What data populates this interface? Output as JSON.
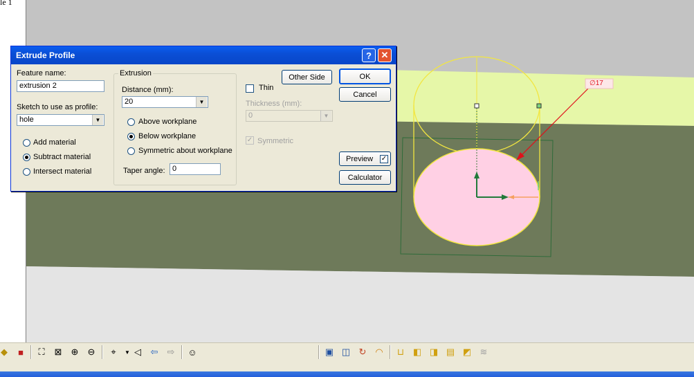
{
  "doc": {
    "fragment": "le 1"
  },
  "dialog": {
    "title": "Extrude Profile",
    "help": "?",
    "close": "✕",
    "feature_name_label": "Feature name:",
    "feature_name_value": "extrusion 2",
    "sketch_label": "Sketch to use as profile:",
    "sketch_value": "hole",
    "ops": [
      "Add material",
      "Subtract material",
      "Intersect material"
    ],
    "ops_selected": 1,
    "extrusion_group": "Extrusion",
    "distance_label": "Distance (mm):",
    "distance_value": "20",
    "direction": [
      "Above workplane",
      "Below workplane",
      "Symmetric about workplane"
    ],
    "direction_selected": 1,
    "taper_label": "Taper angle:",
    "taper_value": "0",
    "other_side": "Other Side",
    "thin_label": "Thin",
    "thin_checked": false,
    "thickness_label": "Thickness (mm):",
    "thickness_value": "0",
    "symmetric_label": "Symmetric",
    "symmetric_checked": true,
    "ok": "OK",
    "cancel": "Cancel",
    "preview": "Preview",
    "preview_checked": true,
    "calculator": "Calculator"
  },
  "viewport": {
    "dimension_label": "∅17"
  },
  "colors": {
    "sky": "#c3c3c3",
    "top_face": "#e6f7a8",
    "side_face": "#6e7a5a",
    "floor": "#e4e4e4",
    "profile_fill": "#ffd0e4",
    "profile_edge": "#f2e640",
    "dim_arrow": "#e0101a"
  },
  "toolbar": {
    "icons": [
      "solid-view-icon",
      "shaded-box-icon",
      "zoom-fit-icon",
      "zoom-window-icon",
      "zoom-in-icon",
      "zoom-out-icon",
      "view-orient-icon",
      "dropdown-arrow-icon",
      "look-at-icon",
      "arrow-left-icon",
      "arrow-right-icon",
      "smiley-icon",
      "extrude-icon",
      "revolve-icon",
      "sweep-icon",
      "loft-icon",
      "shell-icon",
      "box-icon",
      "cylinder-icon",
      "cone-icon",
      "boolean-icon",
      "disabled-feature-icon"
    ]
  }
}
